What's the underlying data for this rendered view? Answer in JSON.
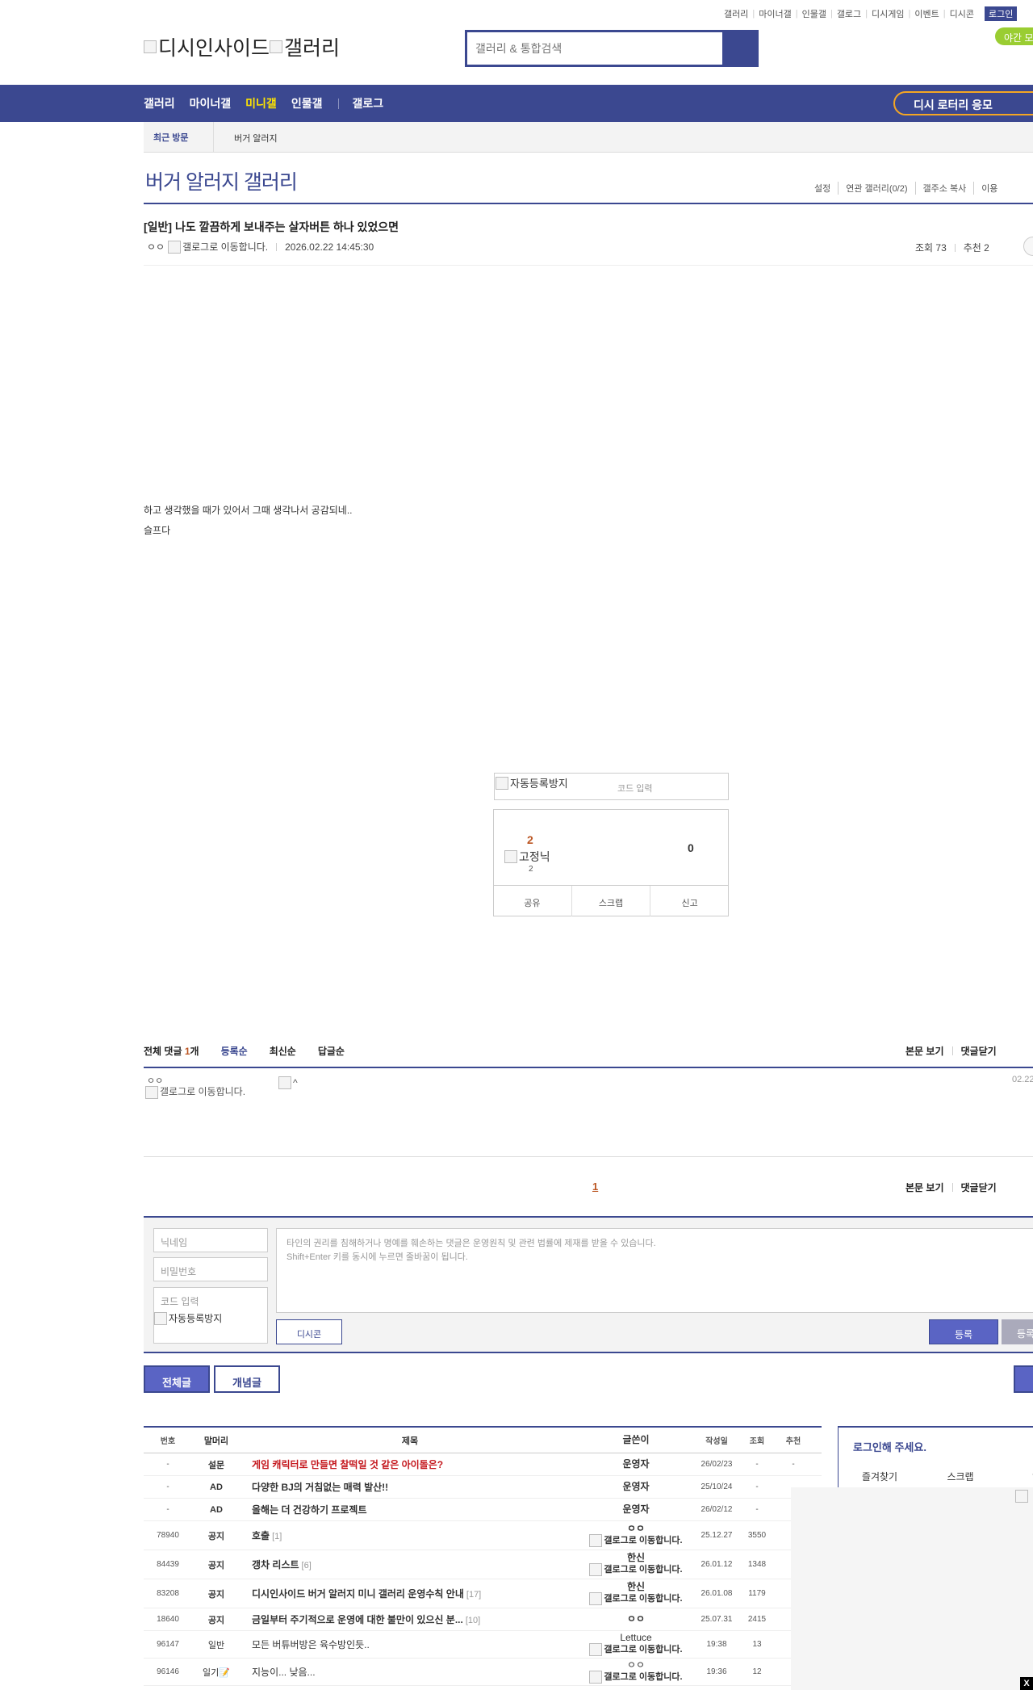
{
  "top_links": [
    "갤러리",
    "마이너갤",
    "인물갤",
    "갤로그",
    "디시게임",
    "이벤트",
    "디시콘"
  ],
  "login_label": "로그인",
  "night_mode_label": "야간 모",
  "logo_alt": "디시인사이드",
  "logo_gallery_alt": "갤러리",
  "search_placeholder": "갤러리 & 통합검색",
  "nav": {
    "items": [
      "갤러리",
      "마이너갤",
      "미니갤",
      "인물갤"
    ],
    "galog": "갤로그",
    "active_index": 2,
    "lottery": "디시 로터리 응모"
  },
  "recent": {
    "label": "최근 방문",
    "item": "버거 알러지"
  },
  "gallery": {
    "title": "버거 알러지 갤러리",
    "menu": [
      "설정",
      "연관 갤러리(0/2)",
      "갤주소 복사",
      "이용"
    ]
  },
  "post": {
    "title": "[일반] 나도 깔끔하게 보내주는 살자버튼 하나 있었으면",
    "author": "ㅇㅇ",
    "galog_alt": "갤로그로 이동합니다.",
    "datetime": "2026.02.22 14:45:30",
    "views_label": "조회 73",
    "reco_label": "추천 2",
    "body": [
      "하고 생각했을 때가 있어서 그때 생각나서 공감되네..",
      "슬프다"
    ]
  },
  "captcha": {
    "img_alt": "자동등록방지",
    "code_placeholder": "코드 입력"
  },
  "recommend": {
    "up": "2",
    "fixed_alt": "고정닉",
    "fixed_count": "2",
    "down": "0",
    "actions": [
      "공유",
      "스크랩",
      "신고"
    ]
  },
  "comments": {
    "label_prefix": "전체 댓글",
    "count": "1",
    "label_suffix": "개",
    "sorts": [
      "등록순",
      "최신순",
      "답글순"
    ],
    "view_body": "본문 보기",
    "close": "댓글닫기",
    "item": {
      "nick": "ㅇㅇ",
      "galog_alt": "갤로그로 이동합니다.",
      "img_alt": "^",
      "date": "02.22"
    },
    "page": "1"
  },
  "comment_form": {
    "nick_placeholder": "닉네임",
    "pw_placeholder": "비밀번호",
    "code_placeholder": "코드 입력",
    "captcha_alt": "자동등록방지",
    "textarea_line1": "타인의 권리를 침해하거나 명예를 훼손하는 댓글은 운영원칙 및 관련 법률에 제재를 받을 수 있습니다.",
    "textarea_line2": "Shift+Enter 키를 동시에 누르면 줄바꿈이 됩니다.",
    "dccon": "디시콘",
    "submit": "등록",
    "submit2": "등록"
  },
  "tabs": {
    "all": "전체글",
    "concept": "개념글"
  },
  "list": {
    "headers": [
      "번호",
      "말머리",
      "제목",
      "글쓴이",
      "작성일",
      "조회",
      "추천"
    ],
    "rows": [
      {
        "no": "-",
        "head": "설문",
        "title": "게임 캐릭터로 만들면 찰떡일 것 같은 아이돌은?",
        "count": "",
        "writer": "운영자",
        "writer_sub": "",
        "date": "26/02/23",
        "views": "-",
        "reco": "-",
        "style": "red"
      },
      {
        "no": "-",
        "head": "AD",
        "title": "다양한 BJ의 거침없는 매력 발산!!",
        "count": "",
        "writer": "운영자",
        "writer_sub": "",
        "date": "25/10/24",
        "views": "-",
        "reco": "",
        "style": "bold"
      },
      {
        "no": "-",
        "head": "AD",
        "title": "올해는 더 건강하기 프로젝트",
        "count": "",
        "writer": "운영자",
        "writer_sub": "",
        "date": "26/02/12",
        "views": "-",
        "reco": "",
        "style": "bold"
      },
      {
        "no": "78940",
        "head": "공지",
        "title": "호출",
        "count": "[1]",
        "writer": "ㅇㅇ",
        "writer_sub": "갤로그로 이동합니다.",
        "date": "25.12.27",
        "views": "3550",
        "reco": "",
        "style": "bold"
      },
      {
        "no": "84439",
        "head": "공지",
        "title": "갱차 리스트",
        "count": "[6]",
        "writer": "한신",
        "writer_sub": "갤로그로 이동합니다.",
        "date": "26.01.12",
        "views": "1348",
        "reco": "",
        "style": "bold"
      },
      {
        "no": "83208",
        "head": "공지",
        "title": "디시인사이드 버거 알러지 미니 갤러리 운영수칙 안내",
        "count": "[17]",
        "writer": "한신",
        "writer_sub": "갤로그로 이동합니다.",
        "date": "26.01.08",
        "views": "1179",
        "reco": "",
        "style": "bold"
      },
      {
        "no": "18640",
        "head": "공지",
        "title": "금일부터 주기적으로 운영에 대한 불만이 있으신 분...",
        "count": "[10]",
        "writer": "ㅇㅇ",
        "writer_sub": "",
        "date": "25.07.31",
        "views": "2415",
        "reco": "",
        "style": "bold"
      },
      {
        "no": "96147",
        "head": "일반",
        "title": "모든 버튜버방은 육수방인듯..",
        "count": "",
        "writer": "Lettuce",
        "writer_sub": "갤로그로 이동합니다.",
        "date": "19:38",
        "views": "13",
        "reco": "",
        "style": "normal"
      },
      {
        "no": "96146",
        "head": "일기📝",
        "title": "지능이... 낮음...",
        "count": "",
        "writer": "ㅇㅇ",
        "writer_sub": "갤로그로 이동합니다.",
        "date": "19:36",
        "views": "12",
        "reco": "",
        "style": "normal"
      }
    ]
  },
  "login_box": {
    "title": "로그인해 주세요.",
    "tabs": [
      "즐겨찾기",
      "스크랩",
      "알림"
    ]
  },
  "close_label": "X"
}
